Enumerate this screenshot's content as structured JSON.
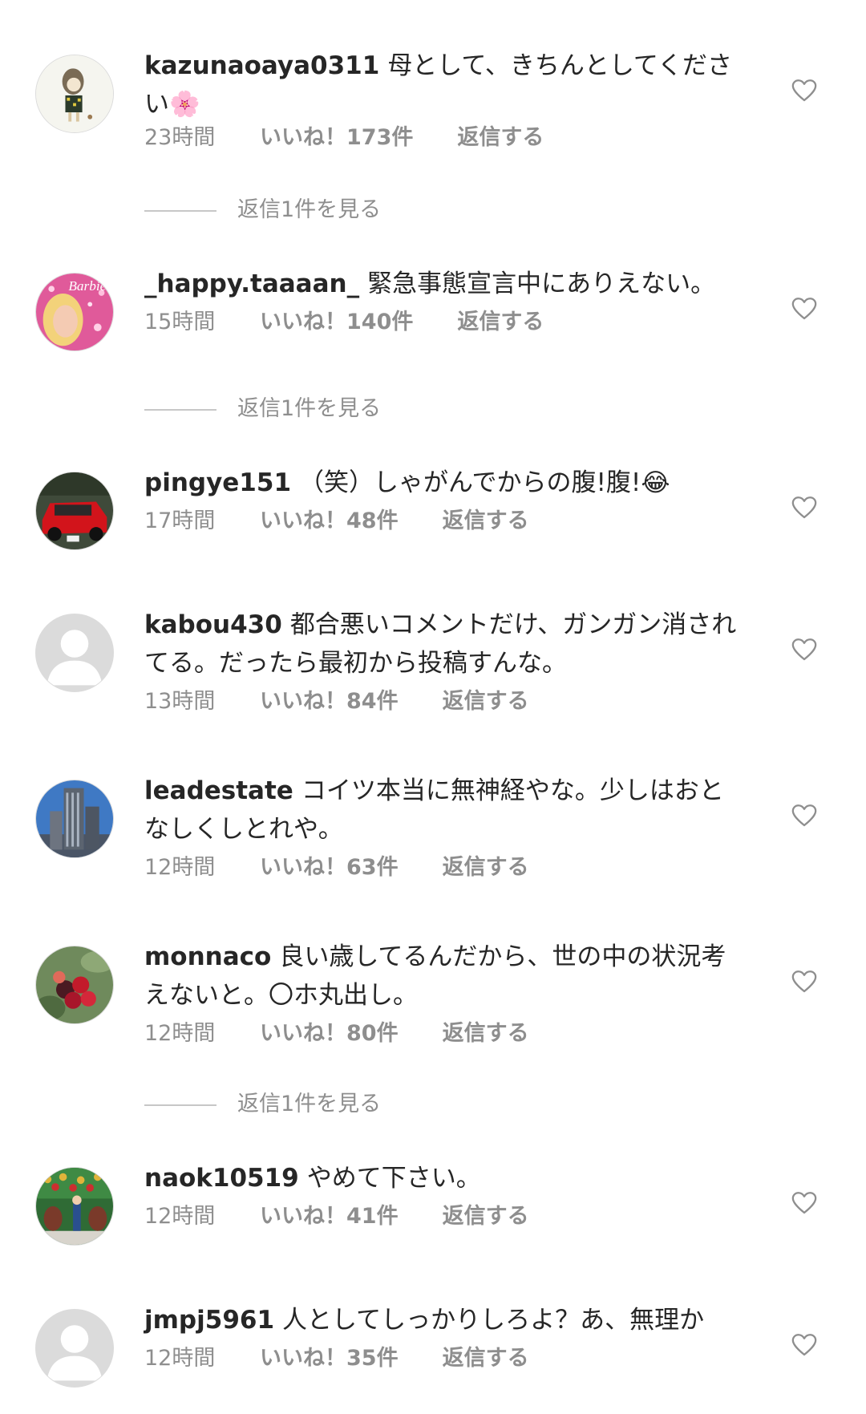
{
  "comments": [
    {
      "username": "kazunaoaya0311",
      "text": "母として、きちんとしてください🌸",
      "time": "23時間",
      "likes": "いいね！173件",
      "reply": "返信する",
      "view_replies": "返信1件を見る"
    },
    {
      "username": "_happy.taaaan_",
      "text": "緊急事態宣言中にありえない。",
      "time": "15時間",
      "likes": "いいね！140件",
      "reply": "返信する",
      "view_replies": "返信1件を見る"
    },
    {
      "username": "pingye151",
      "text": "（笑）しゃがんでからの腹!腹!😂",
      "time": "17時間",
      "likes": "いいね！48件",
      "reply": "返信する"
    },
    {
      "username": "kabou430",
      "text": "都合悪いコメントだけ、ガンガン消されてる。だったら最初から投稿すんな。",
      "time": "13時間",
      "likes": "いいね！84件",
      "reply": "返信する"
    },
    {
      "username": "leadestate",
      "text": "コイツ本当に無神経やな。少しはおとなしくしとれや。",
      "time": "12時間",
      "likes": "いいね！63件",
      "reply": "返信する"
    },
    {
      "username": "monnaco",
      "text": "良い歳してるんだから、世の中の状況考えないと。〇ホ丸出し。",
      "time": "12時間",
      "likes": "いいね！80件",
      "reply": "返信する",
      "view_replies": "返信1件を見る"
    },
    {
      "username": "naok10519",
      "text": "やめて下さい。",
      "time": "12時間",
      "likes": "いいね！41件",
      "reply": "返信する"
    },
    {
      "username": "jmpj5961",
      "text": "人としてしっかりしろよ？あ、無理か",
      "time": "12時間",
      "likes": "いいね！35件",
      "reply": "返信する"
    }
  ],
  "colors": {
    "text": "#262626",
    "meta": "#8e8e8e",
    "divider": "#c7c7c7"
  },
  "icons": {
    "like": "heart-outline-icon"
  }
}
